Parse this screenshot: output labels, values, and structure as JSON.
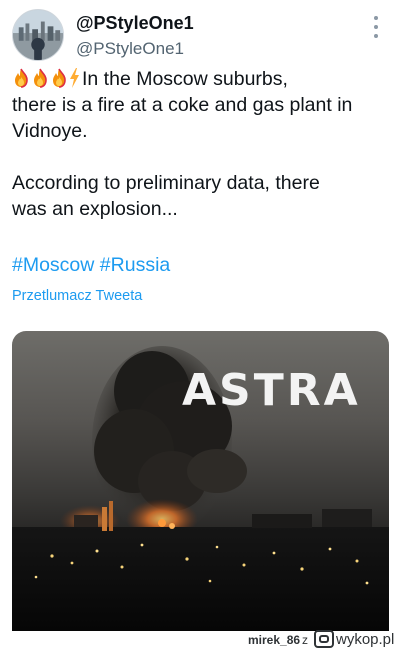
{
  "tweet": {
    "author": {
      "display_name": "@PStyleOne1",
      "handle": "@PStyleOne1",
      "avatar_icon": "avatar-photo"
    },
    "more_icon": "more-vertical-icon",
    "text": {
      "emoji": [
        "fire",
        "fire",
        "fire",
        "lightning"
      ],
      "line1": "In the Moscow suburbs,",
      "line2": "there is a fire at a coke and gas plant in",
      "line3": "Vidnoye.",
      "line4": "According to preliminary data, there",
      "line5": "was an explosion..."
    },
    "hashtags": [
      "#Moscow",
      "#Russia"
    ],
    "translate_label": "Przetlumacz Tweeta",
    "media": {
      "watermark": "ASTRA"
    }
  },
  "footer": {
    "user": "mirek_86",
    "separator": "z",
    "site": "wykop.pl"
  },
  "colors": {
    "link": "#1d9bf0",
    "text": "#0f1419",
    "secondary": "#536471"
  }
}
